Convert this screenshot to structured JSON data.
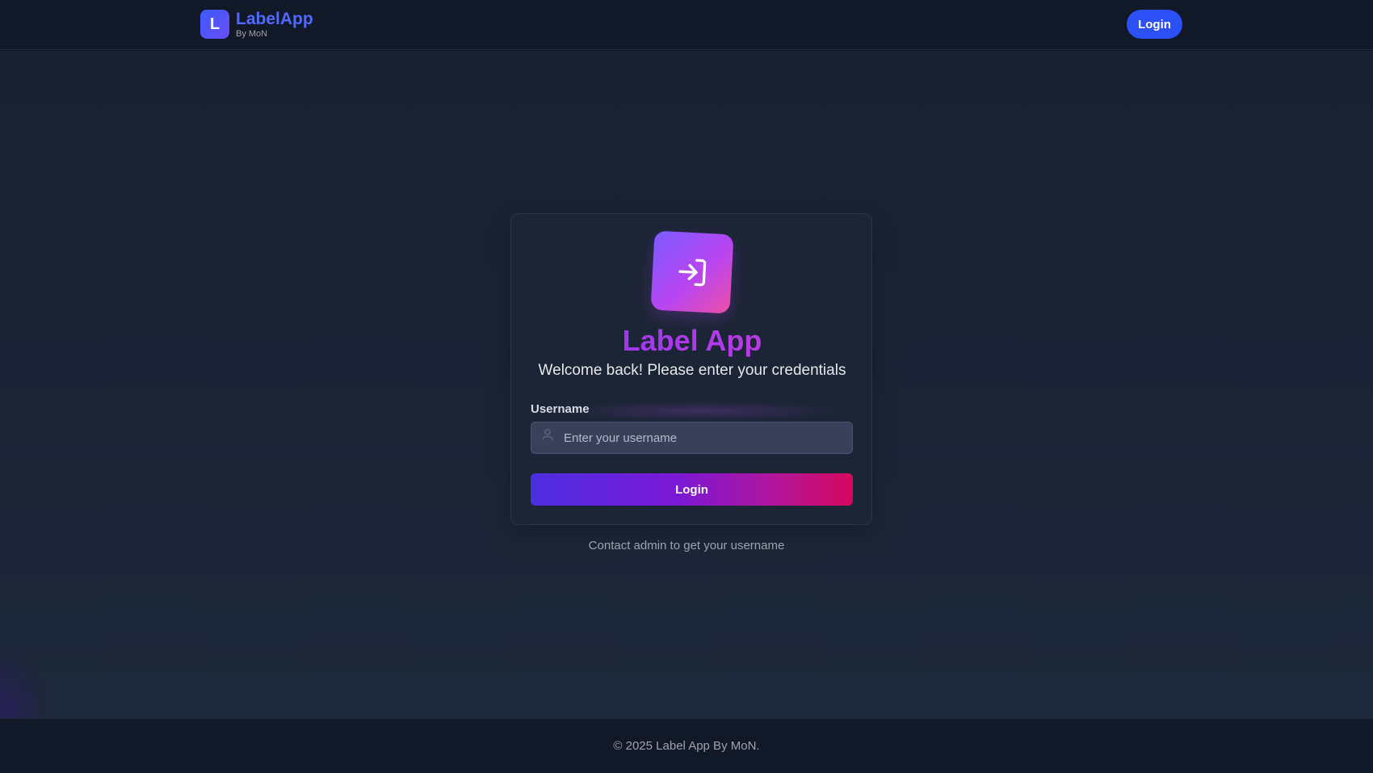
{
  "header": {
    "brand_initial": "L",
    "brand_name": "LabelApp",
    "brand_sub": "By MoN",
    "login_label": "Login"
  },
  "card": {
    "icon": "login-arrow-icon",
    "title": "Label App",
    "subtitle": "Welcome back! Please enter your credentials",
    "username_label": "Username",
    "username_placeholder": "Enter your username",
    "username_value": "",
    "username_icon": "user-icon",
    "submit_label": "Login"
  },
  "contact_text": "Contact admin to get your username",
  "footer": {
    "copyright": "© 2025 Label App By MoN."
  },
  "colors": {
    "accent": "#2b50f5",
    "gradient_start": "#4b2ee0",
    "gradient_end": "#d6085e",
    "background": "#1c2535"
  }
}
